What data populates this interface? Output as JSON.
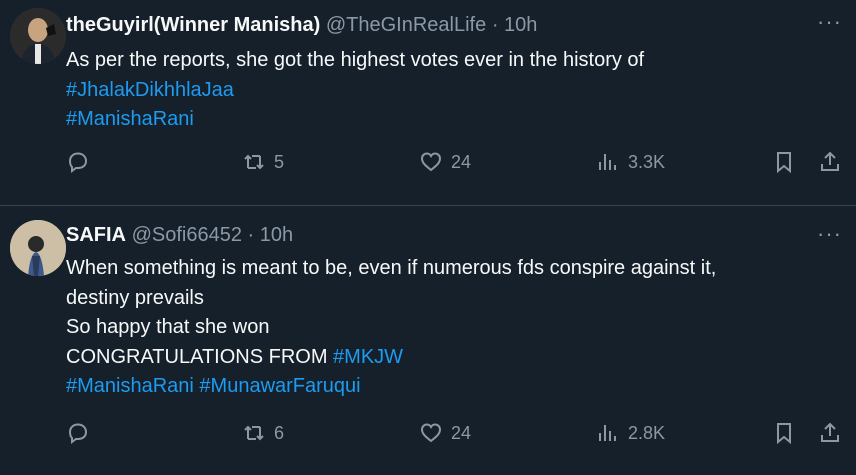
{
  "tweets": [
    {
      "name": "theGuyirl(Winner Manisha)",
      "handle": "@TheGInRealLife",
      "sep": "·",
      "time": "10h",
      "lines": [
        {
          "text": "As per the reports, she got the highest votes ever in the history of"
        },
        {
          "tag": "#JhalakDikhhlaJaa"
        },
        {
          "tag": "#ManishaRani"
        }
      ],
      "reply_count": "",
      "retweet_count": "5",
      "like_count": "24",
      "view_count": "3.3K"
    },
    {
      "name": "SAFIA",
      "handle": "@Sofi66452",
      "sep": "·",
      "time": "10h",
      "lines": [
        {
          "text": "When something is meant to be, even if numerous fds conspire against it,"
        },
        {
          "text": "destiny prevails"
        },
        {
          "text": "So happy that she won"
        },
        {
          "text": "CONGRATULATIONS FROM ",
          "tag": "#MKJW"
        },
        {
          "tag": "#ManishaRani",
          "tag2": "#MunawarFaruqui"
        }
      ],
      "reply_count": "",
      "retweet_count": "6",
      "like_count": "24",
      "view_count": "2.8K"
    }
  ],
  "icons": {
    "more": "more-icon",
    "reply": "reply-icon",
    "retweet": "retweet-icon",
    "like": "heart-icon",
    "views": "views-icon",
    "bookmark": "bookmark-icon",
    "share": "share-icon"
  },
  "colors": {
    "background": "#15202b",
    "text": "#f7f9f9",
    "muted": "#8b98a5",
    "link": "#1d9bf0",
    "divider": "#38444d"
  }
}
